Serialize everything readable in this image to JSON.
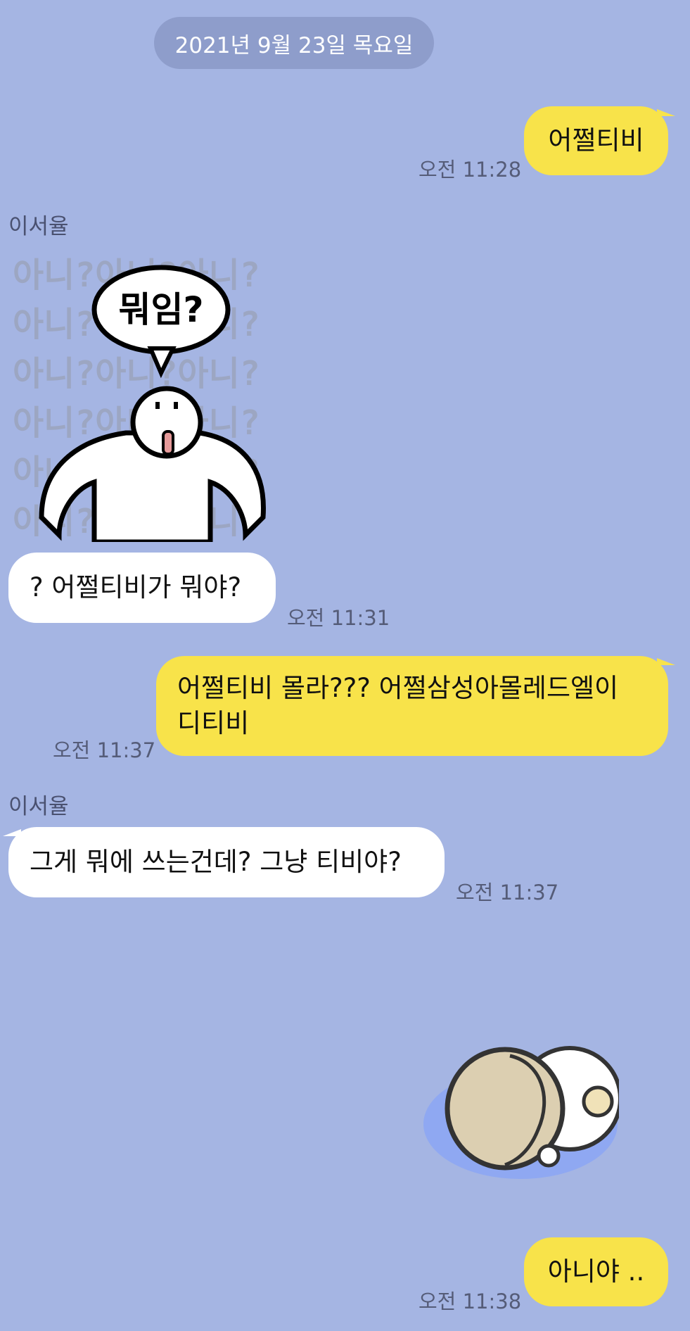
{
  "date_divider": "2021년 9월 23일 목요일",
  "messages": [
    {
      "side": "me",
      "text": "어쩔티비",
      "time": "오전 11:28"
    },
    {
      "side": "them",
      "sender": "이서율",
      "sticker": "pixel-character-wotim-sticker",
      "sticker_text": "뭐임?",
      "sticker_bg": "아니?아니?아니?",
      "text": "? 어쩔티비가 뭐야?",
      "time": "오전 11:31"
    },
    {
      "side": "me",
      "text_line1": "어쩔티비 몰라??? 어쩔삼성아몰레드엘이",
      "text_line2": "디티비",
      "time": "오전 11:37"
    },
    {
      "side": "them",
      "sender": "이서율",
      "text": "그게 뭐에 쓰는건데? 그냥 티비야?",
      "time": "오전 11:37"
    },
    {
      "side": "me",
      "sticker": "lying-character-sticker",
      "text": "아니야 ..",
      "time": "오전 11:38"
    }
  ],
  "colors": {
    "background": "#a5b5e3",
    "my_bubble": "#f8e34a",
    "their_bubble": "#ffffff",
    "date_pill": "#8e9dcb"
  }
}
